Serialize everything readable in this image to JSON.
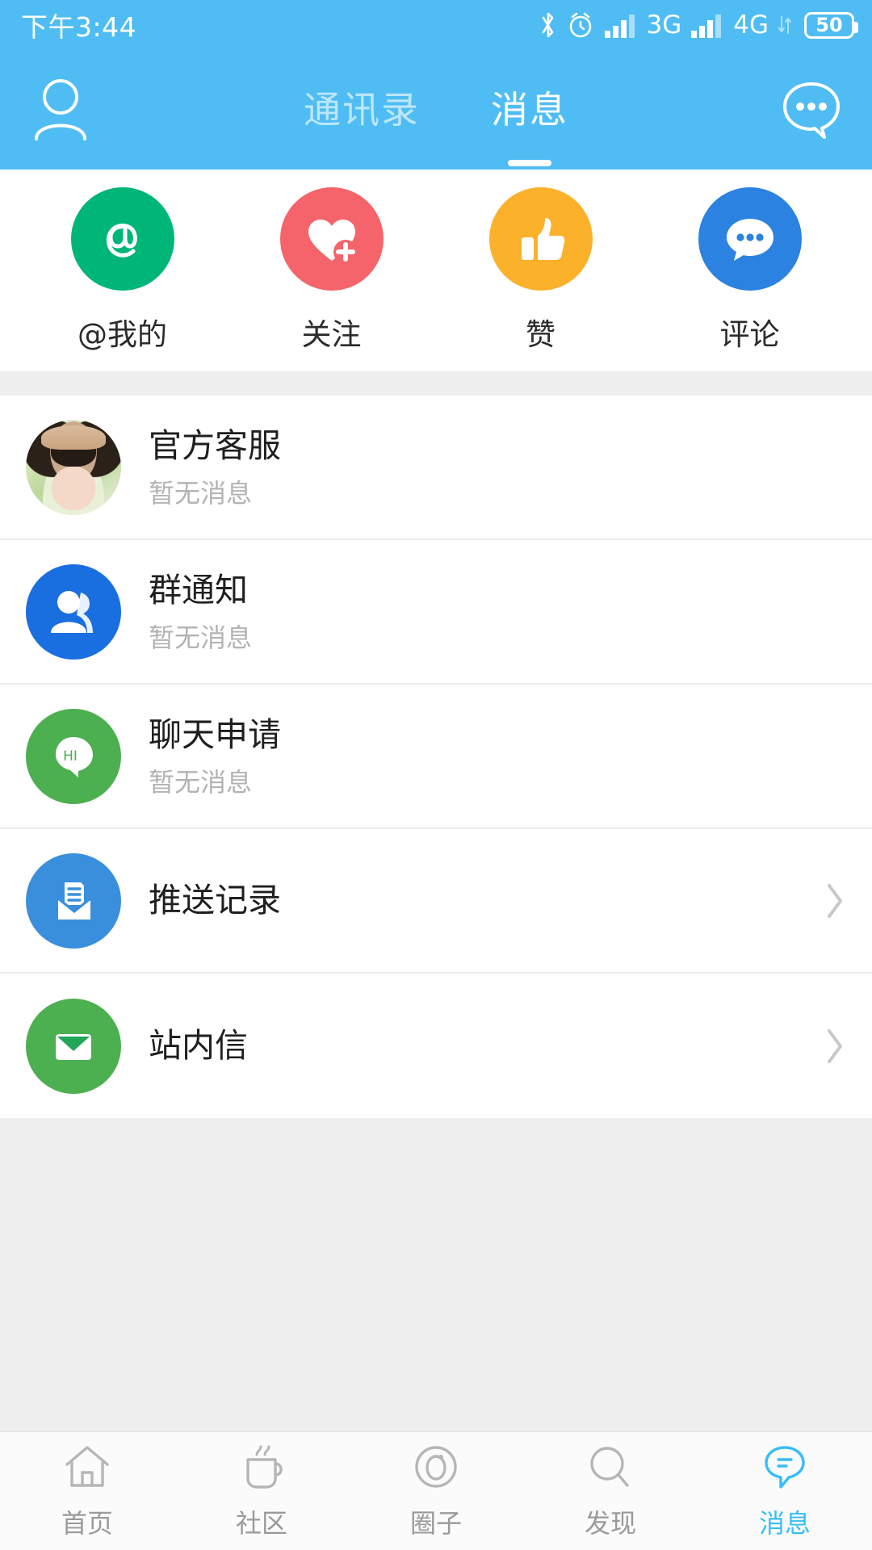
{
  "status_bar": {
    "time": "下午3:44",
    "battery_level": "50",
    "network_1": "3G",
    "network_2": "4G",
    "icons": [
      "bluetooth-icon",
      "alarm-icon",
      "signal-bars-icon",
      "signal-bars-icon",
      "battery-icon"
    ]
  },
  "header": {
    "background_color": "#4fbdf3",
    "profile_icon": "person-outline-icon",
    "chat_icon": "chat-bubble-dots-icon",
    "tabs": [
      {
        "label": "通讯录",
        "active": false
      },
      {
        "label": "消息",
        "active": true
      }
    ]
  },
  "shortcuts": [
    {
      "label": "@我的",
      "icon": "at-sign-icon",
      "color": "#00b578"
    },
    {
      "label": "关注",
      "icon": "heart-plus-icon",
      "color": "#f4646a"
    },
    {
      "label": "赞",
      "icon": "thumbs-up-icon",
      "color": "#fbb12a"
    },
    {
      "label": "评论",
      "icon": "comment-dots-icon",
      "color": "#2b82e0"
    }
  ],
  "messages": [
    {
      "title": "官方客服",
      "subtitle": "暂无消息",
      "icon": "user-photo-avatar",
      "color": "#ffffff",
      "chevron": false
    },
    {
      "title": "群通知",
      "subtitle": "暂无消息",
      "icon": "group-people-icon",
      "color": "#1a6fe0",
      "chevron": false
    },
    {
      "title": "聊天申请",
      "subtitle": "暂无消息",
      "icon": "hi-bubble-icon",
      "color": "#4caf50",
      "chevron": false
    },
    {
      "title": "推送记录",
      "subtitle": "",
      "icon": "push-inbox-icon",
      "color": "#3a8fdc",
      "chevron": true
    },
    {
      "title": "站内信",
      "subtitle": "",
      "icon": "envelope-icon",
      "color": "#4caf50",
      "chevron": true
    }
  ],
  "bottom_nav": [
    {
      "label": "首页",
      "icon": "home-icon",
      "active": false
    },
    {
      "label": "社区",
      "icon": "coffee-cup-icon",
      "active": false
    },
    {
      "label": "圈子",
      "icon": "circle-icon",
      "active": false
    },
    {
      "label": "发现",
      "icon": "search-icon",
      "active": false
    },
    {
      "label": "消息",
      "icon": "message-icon",
      "active": true
    }
  ],
  "theme": {
    "accent": "#4fbdf3",
    "active_nav": "#38bdf8",
    "page_background": "#eeeeee",
    "card_background": "#ffffff"
  }
}
